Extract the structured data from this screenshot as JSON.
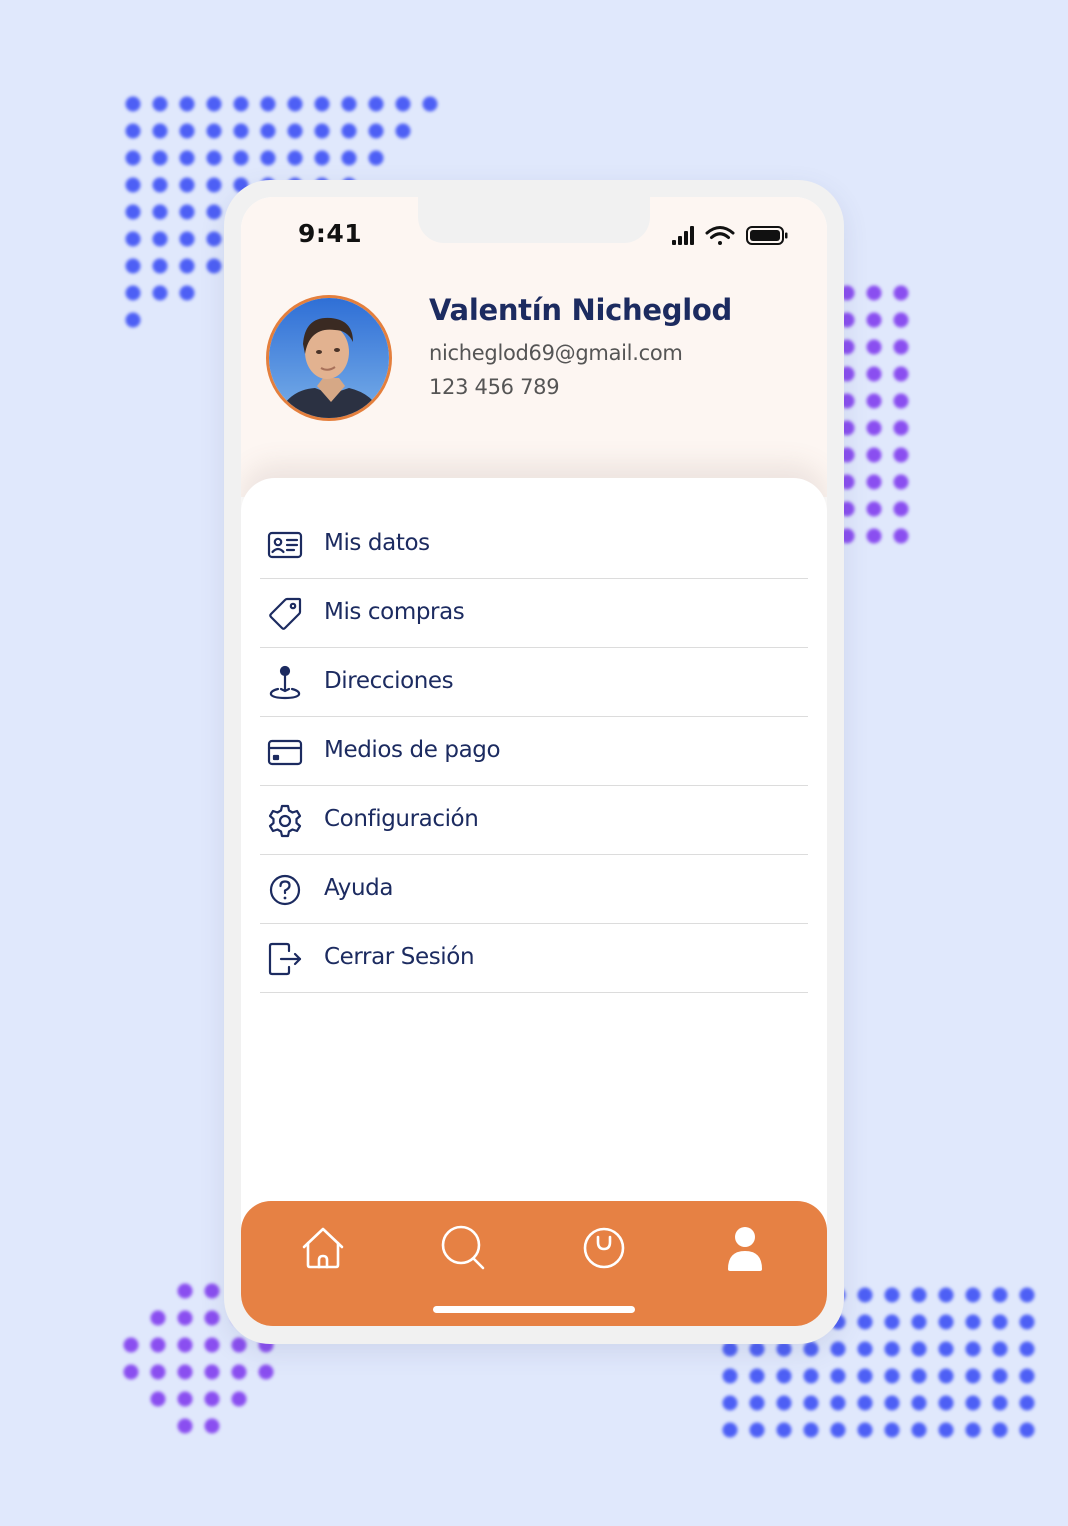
{
  "status_bar": {
    "time": "9:41",
    "icons": [
      "cellular-signal-icon",
      "wifi-icon",
      "battery-icon"
    ]
  },
  "profile": {
    "name": "Valentín Nicheglod",
    "email": "nicheglod69@gmail.com",
    "phone": "123 456 789",
    "avatar_icon": "profile-photo"
  },
  "menu": {
    "items": [
      {
        "label": "Mis datos",
        "icon": "id-card-icon"
      },
      {
        "label": "Mis compras",
        "icon": "tag-icon"
      },
      {
        "label": "Direcciones",
        "icon": "location-pin-icon"
      },
      {
        "label": "Medios de pago",
        "icon": "credit-card-icon"
      },
      {
        "label": "Configuración",
        "icon": "gear-icon"
      },
      {
        "label": "Ayuda",
        "icon": "help-icon"
      },
      {
        "label": "Cerrar Sesión",
        "icon": "logout-icon"
      }
    ]
  },
  "bottom_nav": {
    "items": [
      {
        "icon": "home-icon",
        "active": false
      },
      {
        "icon": "search-icon",
        "active": false
      },
      {
        "icon": "shopping-bag-icon",
        "active": false
      },
      {
        "icon": "user-icon",
        "active": true
      }
    ]
  },
  "colors": {
    "background": "#e0e8fc",
    "accent_orange": "#e68144",
    "text_navy": "#1c2b60",
    "header_bg": "#fdf6f2",
    "dots_blue": "#4d5ff5",
    "dots_purple": "#8a4ef0"
  }
}
